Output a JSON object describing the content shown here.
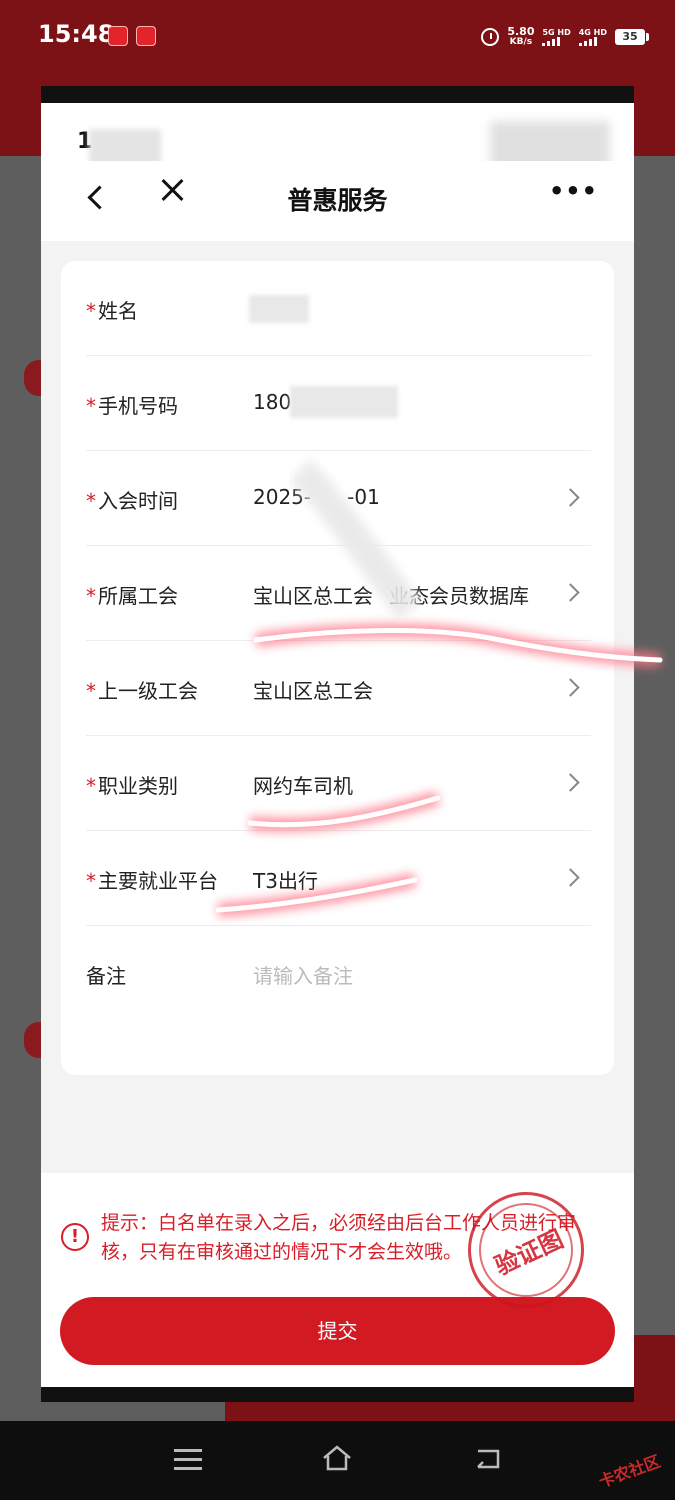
{
  "status_bar": {
    "time": "15:48",
    "speed_value": "5.80",
    "speed_unit": "KB/s",
    "net1": "5G HD",
    "net2": "4G HD",
    "battery": "35"
  },
  "inner_status": {
    "time": "1"
  },
  "nav": {
    "title": "普惠服务",
    "more": "•••"
  },
  "form": {
    "rows": [
      {
        "label": "姓名",
        "value": "",
        "required": true
      },
      {
        "label": "手机号码",
        "value": "180",
        "required": true
      },
      {
        "label": "入会时间",
        "value": "2025-",
        "value2": "-01",
        "required": true
      },
      {
        "label": "所属工会",
        "value": "宝山区总工会",
        "value2": "业态会员数据库",
        "required": true
      },
      {
        "label": "上一级工会",
        "value": "宝山区总工会",
        "required": true
      },
      {
        "label": "职业类别",
        "value": "网约车司机",
        "required": true
      },
      {
        "label": "主要就业平台",
        "value": "T3出行",
        "required": true
      },
      {
        "label": "备注",
        "placeholder": "请输入备注",
        "required": false
      }
    ],
    "required_mark": "*"
  },
  "notice": {
    "icon": "!",
    "text": "提示：白名单在录入之后，必须经由后台工作人员进行审核，只有在审核通过的情况下才会生效哦。"
  },
  "submit_label": "提交",
  "stamp_text": "验证图",
  "watermark": "卡农社区",
  "colors": {
    "brand_red": "#d21a22",
    "header_red": "#7c1216",
    "notice_red": "#d81e28"
  }
}
